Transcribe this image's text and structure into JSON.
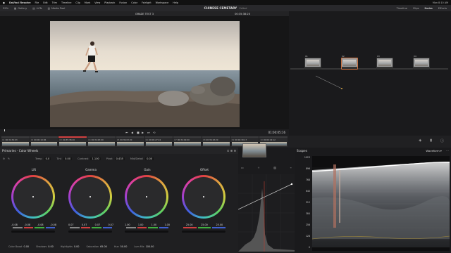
{
  "menubar": {
    "app_name": "DaVinci Resolve",
    "items": [
      "File",
      "Edit",
      "Trim",
      "Timeline",
      "Clip",
      "Mark",
      "View",
      "Playback",
      "Fusion",
      "Color",
      "Fairlight",
      "Workspace",
      "Help"
    ],
    "status": "Mon 8:10 AM"
  },
  "toolbar": {
    "zoom": "59%",
    "items": [
      "Gallery",
      "LUTs",
      "Media Pool"
    ],
    "project_title": "CHINESE CEMETARY",
    "project_status": "Edited",
    "right_items": [
      "Timeline",
      "Clips",
      "Nodes",
      "Effects"
    ]
  },
  "viewer_header": {
    "title": "GRADE TEST 3",
    "timecode": "00:35:38:20",
    "clip_label": "Clip"
  },
  "transport": {
    "timecode": "01:00:05:16"
  },
  "clips": [
    {
      "num": "01",
      "tc": "00:34:34:03"
    },
    {
      "num": "02",
      "tc": "00:00:19:06"
    },
    {
      "num": "03",
      "tc": "00:35:38:20"
    },
    {
      "num": "04",
      "tc": "00:34:25:00"
    },
    {
      "num": "05",
      "tc": "00:36:03:20"
    },
    {
      "num": "06",
      "tc": "00:00:27:24"
    },
    {
      "num": "07",
      "tc": "00:34:02:00"
    },
    {
      "num": "08",
      "tc": "00:36:18:20"
    },
    {
      "num": "09",
      "tc": "00:02:30:17"
    },
    {
      "num": "10",
      "tc": "00:00:42:12"
    }
  ],
  "nodes": [
    {
      "label": "01"
    },
    {
      "label": "02"
    },
    {
      "label": "03"
    },
    {
      "label": "04"
    }
  ],
  "color_panel": {
    "title": "Primaries - Color Wheels",
    "temp_label": "Temp",
    "temp_value": "0.0",
    "tint_label": "Tint",
    "tint_value": "0.00",
    "contrast_label": "Contrast",
    "contrast_value": "1.100",
    "pivot_label": "Pivot",
    "pivot_value": "0.435",
    "middetail_label": "Mid/Detail",
    "middetail_value": "0.00"
  },
  "wheels": [
    {
      "name": "Lift",
      "values": [
        "-0.08",
        "-0.08",
        "-0.08",
        "-0.08"
      ]
    },
    {
      "name": "Gamma",
      "values": [
        "0.07",
        "0.07",
        "0.07",
        "0.07"
      ]
    },
    {
      "name": "Gain",
      "values": [
        "1.00",
        "1.00",
        "1.00",
        "1.00"
      ]
    },
    {
      "name": "Offset",
      "values": [
        "25.00",
        "25.00",
        "25.00"
      ]
    }
  ],
  "bottom_params": {
    "colorboost_label": "Color Boost",
    "colorboost_value": "0.00",
    "shadows_label": "Shadows",
    "shadows_value": "0.00",
    "highlights_label": "Highlights",
    "highlights_value": "0.00",
    "saturation_label": "Saturation",
    "saturation_value": "65.00",
    "hue_label": "Hue",
    "hue_value": "50.00",
    "lummix_label": "Lum Mix",
    "lummix_value": "100.00"
  },
  "scopes": {
    "title": "Scopes",
    "mode": "Waveform",
    "scale": [
      "1023",
      "896",
      "768",
      "640",
      "512",
      "384",
      "256",
      "128",
      "0"
    ]
  },
  "colors": {
    "accent_red": "#d04040",
    "panel_bg": "#1f1f21"
  }
}
